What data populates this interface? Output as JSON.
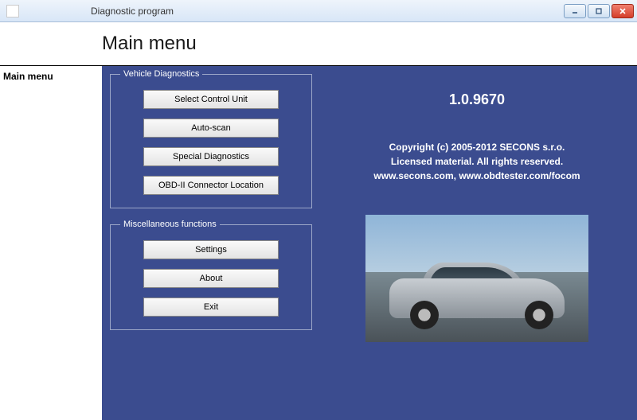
{
  "window": {
    "title": "Diagnostic program"
  },
  "header": {
    "title": "Main menu"
  },
  "sidebar": {
    "items": [
      {
        "label": "Main menu"
      }
    ]
  },
  "groups": {
    "diagnostics": {
      "legend": "Vehicle Diagnostics",
      "buttons": {
        "select_unit": "Select Control Unit",
        "auto_scan": "Auto-scan",
        "special": "Special Diagnostics",
        "connector": "OBD-II Connector Location"
      }
    },
    "misc": {
      "legend": "Miscellaneous functions",
      "buttons": {
        "settings": "Settings",
        "about": "About",
        "exit": "Exit"
      }
    }
  },
  "info": {
    "version": "1.0.9670",
    "copyright_line1": "Copyright (c) 2005-2012 SECONS s.r.o.",
    "copyright_line2": "Licensed material. All rights reserved.",
    "copyright_line3": "www.secons.com, www.obdtester.com/focom"
  }
}
